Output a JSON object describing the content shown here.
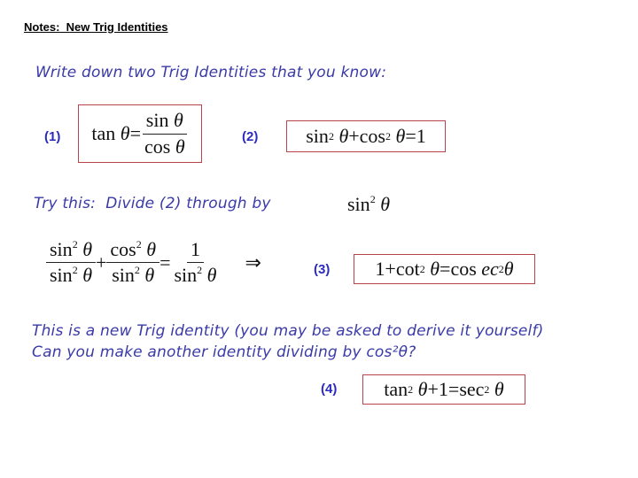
{
  "header": {
    "title": "Notes:  New Trig Identities"
  },
  "prompts": {
    "write_down": "Write down two Trig Identities that you know:",
    "try_this": "Try this:  Divide (2) through by",
    "new_identity_line1": "This is a new Trig identity (you may be asked to derive it yourself)",
    "new_identity_line2": "Can you make another identity dividing by cos²θ?"
  },
  "labels": {
    "one": "(1)",
    "two": "(2)",
    "three": "(3)",
    "four": "(4)"
  },
  "math": {
    "tan": "tan",
    "sin": "sin",
    "cos": "cos",
    "cot": "cot",
    "sec": "sec",
    "cosec": "cos",
    "ec": "ec",
    "theta": "θ",
    "sq": "2",
    "eq": " = ",
    "plus": " + ",
    "one": "1",
    "implies": "⇒",
    "cosec_sq_note": "cosec²θ"
  },
  "colors": {
    "handwriting": "#3a3aa8",
    "label": "#2b2bbf",
    "box_border": "#b8434a"
  }
}
